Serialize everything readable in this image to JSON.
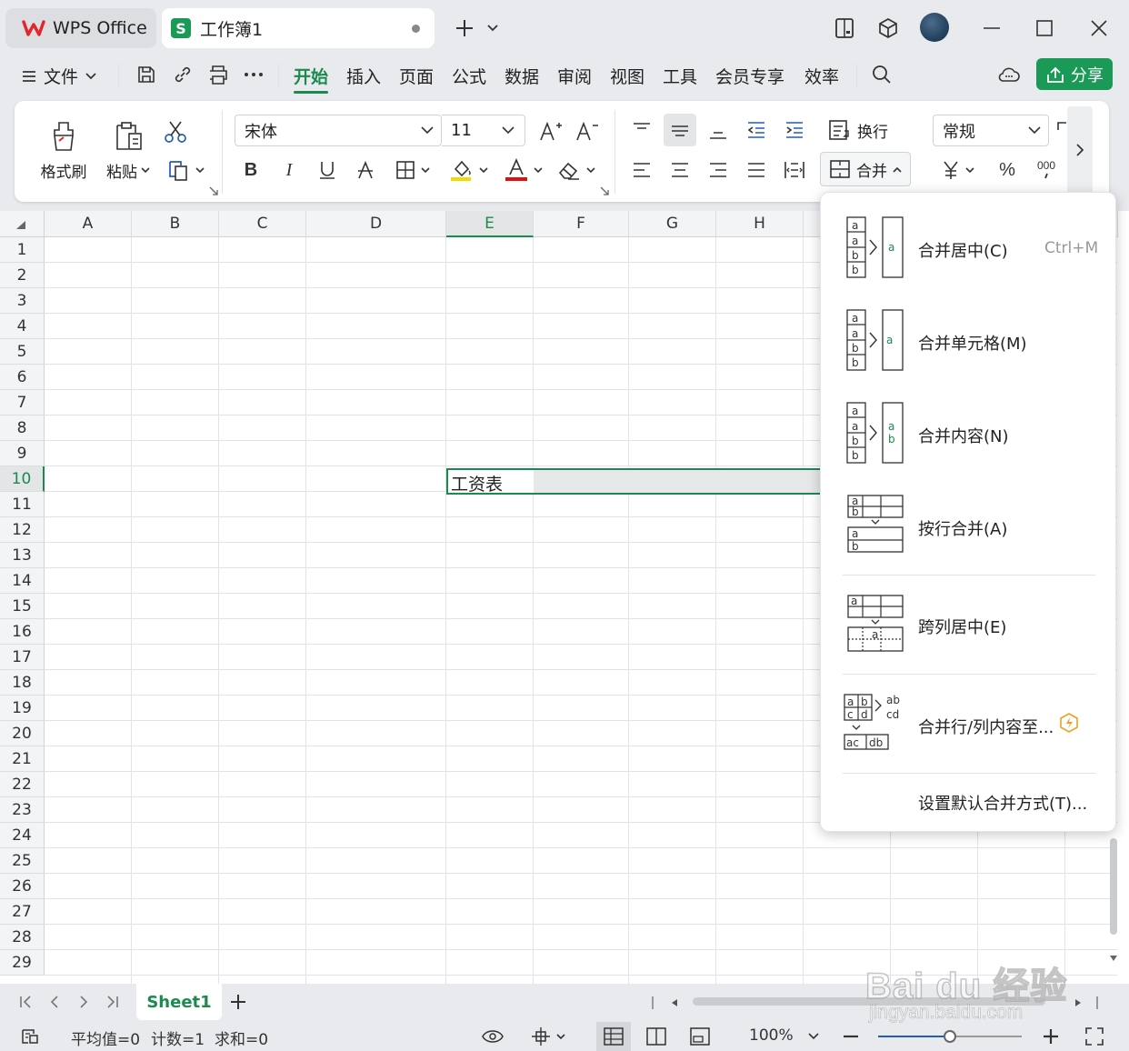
{
  "titlebar": {
    "app_tab": "WPS Office",
    "doc_tab": "工作簿1",
    "doc_icon_letter": "S"
  },
  "menubar": {
    "file": "文件",
    "items": [
      "开始",
      "插入",
      "页面",
      "公式",
      "数据",
      "审阅",
      "视图",
      "工具",
      "会员专享",
      "效率"
    ],
    "active": "开始",
    "share": "分享"
  },
  "ribbon": {
    "format_painter": "格式刷",
    "paste": "粘贴",
    "font_name": "宋体",
    "font_size": "11",
    "wrap_text": "换行",
    "merge": "合并",
    "number_format": "常规"
  },
  "sheet": {
    "columns": [
      "A",
      "B",
      "C",
      "D",
      "E",
      "F",
      "G",
      "H"
    ],
    "selected_column": "E",
    "rows": [
      "1",
      "2",
      "3",
      "4",
      "5",
      "6",
      "7",
      "8",
      "9",
      "10",
      "11",
      "12",
      "13",
      "14",
      "15",
      "16",
      "17",
      "18",
      "19",
      "20",
      "21",
      "22",
      "23",
      "24",
      "25",
      "26",
      "27",
      "28",
      "29"
    ],
    "selected_row": "10",
    "cell_E10": "工资表"
  },
  "merge_menu": {
    "items": [
      {
        "label": "合并居中(C)",
        "shortcut": "Ctrl+M"
      },
      {
        "label": "合并单元格(M)"
      },
      {
        "label": "合并内容(N)"
      },
      {
        "label": "按行合并(A)"
      },
      {
        "label": "跨列居中(E)"
      },
      {
        "label": "合并行/列内容至..."
      },
      {
        "label": "设置默认合并方式(T)..."
      }
    ]
  },
  "sheet_tabs": {
    "active": "Sheet1"
  },
  "statusbar": {
    "average": "平均值=0",
    "count": "计数=1",
    "sum": "求和=0",
    "zoom": "100%"
  },
  "watermark": {
    "logo_text": "Bai du 经验",
    "url": "jingyan.baidu.com"
  },
  "colors": {
    "accent": "#1c8a4f",
    "share_bg": "#1a9a56",
    "wps_red": "#e3262b"
  }
}
